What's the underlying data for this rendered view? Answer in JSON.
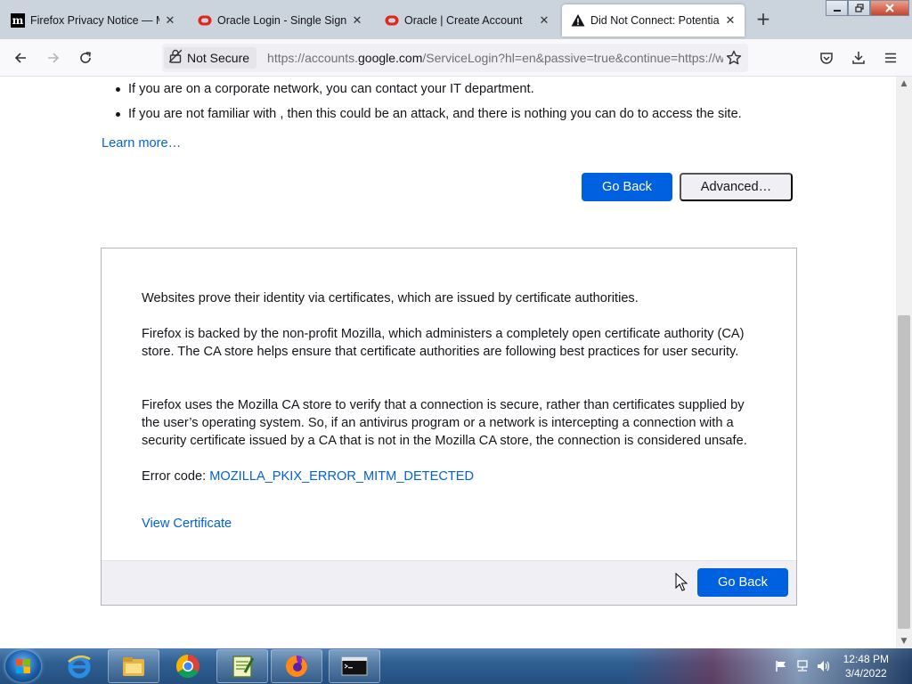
{
  "window": {
    "tabs": [
      {
        "title": "Firefox Privacy Notice — Mo",
        "icon": "mozilla-m-icon",
        "active": false
      },
      {
        "title": "Oracle Login - Single Sign On",
        "icon": "oracle-icon",
        "active": false
      },
      {
        "title": "Oracle | Create Account",
        "icon": "oracle-icon",
        "active": false
      },
      {
        "title": "Did Not Connect: Potential S",
        "icon": "warning-icon",
        "active": true
      }
    ],
    "new_tab_label": "+",
    "close_glyph": "✕"
  },
  "navbar": {
    "not_secure_label": "Not Secure",
    "url_prefix": "https://accounts.",
    "url_host": "google.com",
    "url_suffix": "/ServiceLogin?hl=en&passive=true&continue=https://w"
  },
  "page": {
    "bullets": [
      "If you are on a corporate network, you can contact your IT department.",
      "If you are not familiar with , then this could be an attack, and there is nothing you can do to access the site."
    ],
    "learn_more": "Learn more…",
    "go_back_label": "Go Back",
    "advanced_label": "Advanced…",
    "advanced_panel": {
      "para1": "Websites prove their identity via certificates, which are issued by certificate authorities.",
      "para2": "Firefox is backed by the non-profit Mozilla, which administers a completely open certificate authority (CA) store. The CA store helps ensure that certificate authorities are following best practices for user security.",
      "para3": "Firefox uses the Mozilla CA store to verify that a connection is secure, rather than certificates supplied by the user’s operating system. So, if an antivirus program or a network is intercepting a connection with a security certificate issued by a CA that is not in the Mozilla CA store, the connection is considered unsafe.",
      "error_code_label": "Error code: ",
      "error_code": "MOZILLA_PKIX_ERROR_MITM_DETECTED",
      "view_certificate": "View Certificate",
      "go_back_label": "Go Back"
    }
  },
  "taskbar": {
    "items": [
      {
        "name": "internet-explorer-icon",
        "open": false
      },
      {
        "name": "file-explorer-icon",
        "open": true
      },
      {
        "name": "chrome-icon",
        "open": false
      },
      {
        "name": "notepad-plus-icon",
        "open": true
      },
      {
        "name": "firefox-icon",
        "open": true
      },
      {
        "name": "command-prompt-icon",
        "open": true
      }
    ],
    "clock_time": "12:48 PM",
    "clock_date": "3/4/2022"
  },
  "colors": {
    "primary_button": "#0061e0",
    "link": "#0060df",
    "tabstrip": "#cbd3dd"
  }
}
